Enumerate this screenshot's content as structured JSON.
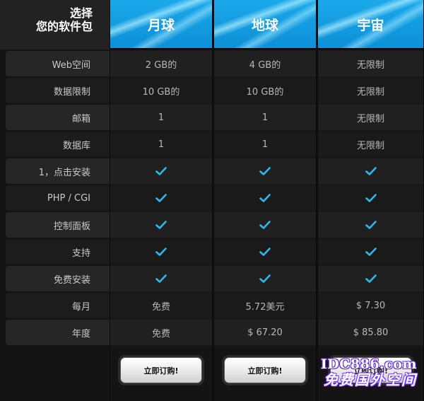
{
  "header": {
    "choose_line1": "选择",
    "choose_line2": "您的软件包"
  },
  "plans": [
    {
      "name": "月球",
      "cta": "立即订购!"
    },
    {
      "name": "地球",
      "cta": "立即订购!"
    },
    {
      "name": "宇宙",
      "cta": "立即订购!"
    }
  ],
  "rows": [
    {
      "label": "Web空间",
      "values": [
        "2 GB的",
        "4 GB的",
        "无限制"
      ]
    },
    {
      "label": "数据限制",
      "values": [
        "10 GB的",
        "10 GB的",
        "无限制"
      ]
    },
    {
      "label": "邮箱",
      "values": [
        "1",
        "1",
        "无限制"
      ]
    },
    {
      "label": "数据库",
      "values": [
        "1",
        "1",
        "无限制"
      ]
    },
    {
      "label": "1，点击安装",
      "values": [
        "check",
        "check",
        "check"
      ]
    },
    {
      "label": "PHP / CGI",
      "values": [
        "check",
        "check",
        "check"
      ]
    },
    {
      "label": "控制面板",
      "values": [
        "check",
        "check",
        "check"
      ]
    },
    {
      "label": "支持",
      "values": [
        "check",
        "check",
        "check"
      ]
    },
    {
      "label": "免费安装",
      "values": [
        "check",
        "check",
        "check"
      ]
    },
    {
      "label": "每月",
      "values": [
        "免费",
        "5.72美元",
        "$ 7.30"
      ]
    },
    {
      "label": "年度",
      "values": [
        "免费",
        "$ 67.20",
        "$ 85.80"
      ]
    }
  ],
  "watermark": {
    "line1": "IDC886.com",
    "line2": "免费国外空间"
  },
  "colors": {
    "accent_header": "#1aa9ea",
    "checkmark": "#2fb8ee"
  },
  "icons": {
    "feature_included": "check-icon"
  }
}
